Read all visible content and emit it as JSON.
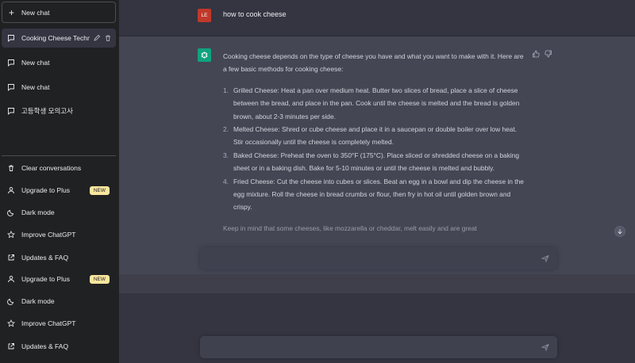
{
  "sidebar": {
    "new_chat_label": "New chat",
    "chats": [
      {
        "label": "Cooking Cheese Techni",
        "icon": "chat-bubble-icon",
        "active": true
      },
      {
        "label": "New chat",
        "icon": "chat-bubble-icon"
      },
      {
        "label": "New chat",
        "icon": "chat-bubble-icon"
      },
      {
        "label": "고등학생 모의고사",
        "icon": "chat-bubble-icon"
      }
    ],
    "menu": [
      {
        "label": "Clear conversations",
        "icon": "trash-icon"
      },
      {
        "label": "Upgrade to Plus",
        "icon": "user-icon",
        "badge": "NEW"
      },
      {
        "label": "Dark mode",
        "icon": "moon-icon"
      },
      {
        "label": "Improve ChatGPT",
        "icon": "star-icon"
      },
      {
        "label": "Updates & FAQ",
        "icon": "external-link-icon"
      },
      {
        "label": "Upgrade to Plus",
        "icon": "user-icon",
        "badge": "NEW"
      },
      {
        "label": "Dark mode",
        "icon": "moon-icon"
      },
      {
        "label": "Improve ChatGPT",
        "icon": "star-icon"
      },
      {
        "label": "Updates & FAQ",
        "icon": "external-link-icon"
      }
    ]
  },
  "conversation": {
    "user": {
      "avatar_text": "LE",
      "message": "how to cook  cheese"
    },
    "assistant": {
      "intro": "Cooking cheese depends on the type of cheese you have and what you want to make with it. Here are a few basic methods for cooking cheese:",
      "items": [
        {
          "num": "1.",
          "text": "Grilled Cheese: Heat a pan over medium heat. Butter two slices of bread, place a slice of cheese between the bread, and place in the pan. Cook until the cheese is melted and the bread is golden brown, about 2-3 minutes per side."
        },
        {
          "num": "2.",
          "text": "Melted Cheese: Shred or cube cheese and place it in a saucepan or double boiler over low heat. Stir occasionally until the cheese is completely melted."
        },
        {
          "num": "3.",
          "text": "Baked Cheese: Preheat the oven to 350°F (175°C). Place sliced or shredded cheese on a baking sheet or in a baking dish. Bake for 5-10 minutes or until the cheese is melted and bubbly."
        },
        {
          "num": "4.",
          "text": "Fried Cheese: Cut the cheese into cubes or slices. Beat an egg in a bowl and dip the cheese in the egg mixture. Roll the cheese in bread crumbs or flour, then fry in hot oil until golden brown and crispy."
        }
      ],
      "trailing": "Keep in mind that some cheeses, like mozzarella or cheddar, melt easily and are great"
    }
  },
  "colors": {
    "sidebar_bg": "#202123",
    "main_bg": "#343541",
    "assistant_bg": "#444654",
    "user_avatar": "#c0392b",
    "assistant_avatar": "#10a37f",
    "badge": "#fae69e"
  }
}
